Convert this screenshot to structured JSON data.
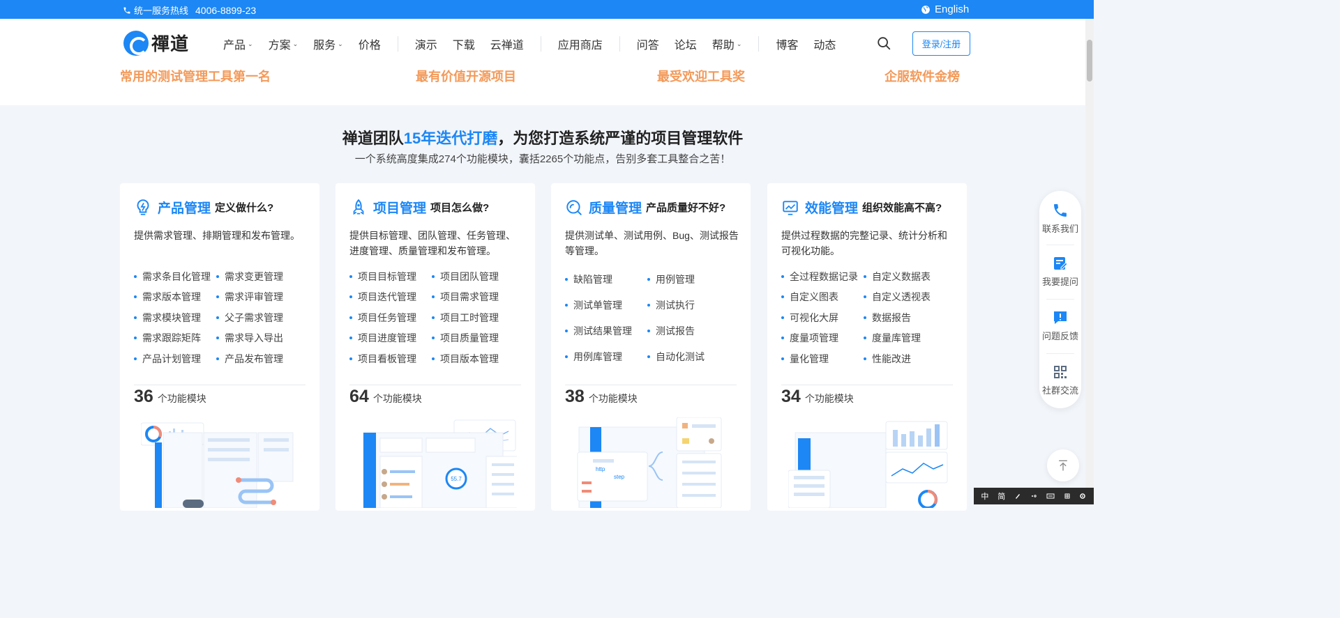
{
  "topbar": {
    "hotline_label": "统一服务热线",
    "hotline_number": "4006-8899-23",
    "language": "English"
  },
  "logo": {
    "text": "禪道"
  },
  "nav": {
    "products": "产品",
    "solutions": "方案",
    "services": "服务",
    "pricing": "价格",
    "demo": "演示",
    "download": "下载",
    "cloud": "云禅道",
    "app_store": "应用商店",
    "qa": "问答",
    "forum": "论坛",
    "help": "帮助",
    "blog": "博客",
    "news": "动态",
    "login": "登录/注册"
  },
  "awards": [
    "常用的测试管理工具第一名",
    "最有价值开源项目",
    "最受欢迎工具奖",
    "企服软件金榜"
  ],
  "headline": {
    "part1": "禅道团队",
    "highlight": "15年迭代打磨",
    "part2": "，为您打造系统严谨的项目管理软件",
    "sub": "一个系统高度集成274个功能模块，囊括2265个功能点，告别多套工具整合之苦！"
  },
  "cards": [
    {
      "title": "产品管理",
      "question": "定义做什么?",
      "desc": "提供需求管理、排期管理和发布管理。",
      "features": [
        "需求条目化管理",
        "需求变更管理",
        "需求版本管理",
        "需求评审管理",
        "需求模块管理",
        "父子需求管理",
        "需求跟踪矩阵",
        "需求导入导出",
        "产品计划管理",
        "产品发布管理"
      ],
      "count": "36",
      "count_unit": "个功能模块"
    },
    {
      "title": "项目管理",
      "question": "项目怎么做?",
      "desc": "提供目标管理、团队管理、任务管理、进度管理、质量管理和发布管理。",
      "features": [
        "项目目标管理",
        "项目团队管理",
        "项目迭代管理",
        "项目需求管理",
        "项目任务管理",
        "项目工时管理",
        "项目进度管理",
        "项目质量管理",
        "项目看板管理",
        "项目版本管理"
      ],
      "count": "64",
      "count_unit": "个功能模块",
      "chart_value": "55.7"
    },
    {
      "title": "质量管理",
      "question": "产品质量好不好?",
      "desc": "提供测试单、测试用例、Bug、测试报告等管理。",
      "features": [
        "缺陷管理",
        "用例管理",
        "测试单管理",
        "测试执行",
        "测试结果管理",
        "测试报告",
        "用例库管理",
        "自动化测试"
      ],
      "count": "38",
      "count_unit": "个功能模块",
      "illus_text": [
        "http",
        "step"
      ]
    },
    {
      "title": "效能管理",
      "question": "组织效能高不高?",
      "desc": "提供过程数据的完整记录、统计分析和可视化功能。",
      "features": [
        "全过程数据记录",
        "自定义数据表",
        "自定义图表",
        "自定义透视表",
        "可视化大屏",
        "数据报告",
        "度量项管理",
        "度量库管理",
        "量化管理",
        "性能改进"
      ],
      "count": "34",
      "count_unit": "个功能模块"
    }
  ],
  "float_panel": {
    "contact": "联系我们",
    "ask": "我要提问",
    "feedback": "问题反馈",
    "community": "社群交流"
  },
  "ime": [
    "中",
    "简"
  ],
  "colors": {
    "primary": "#1c87f5",
    "award": "#f39a5a",
    "bg": "#f2f5fa"
  }
}
